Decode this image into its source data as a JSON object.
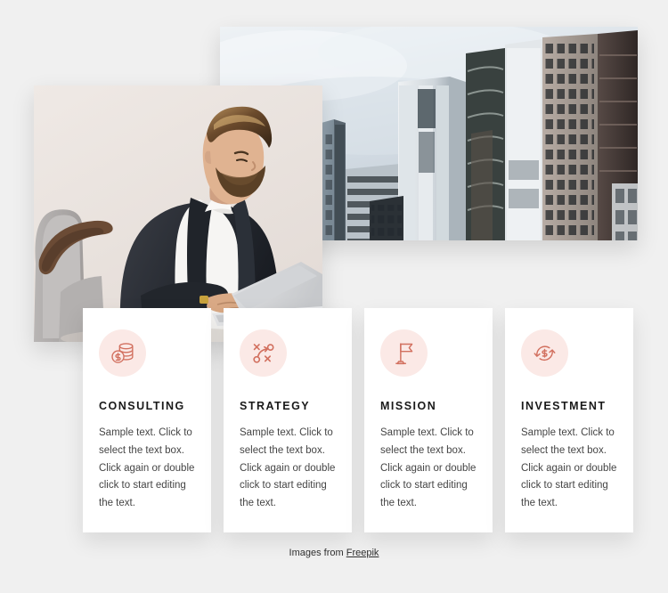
{
  "page": {
    "background_color": "#f0f0f0",
    "accent_color": "#d2705f",
    "icon_bg_color": "#fbe9e6",
    "card_bg_color": "#ffffff",
    "title_color": "#191919",
    "body_color": "#454545"
  },
  "media": [
    {
      "name": "city-buildings-photo",
      "alt": "Modern high-rise office buildings photographed from below against an overcast sky"
    },
    {
      "name": "businessman-laptop-photo",
      "alt": "Bearded man in a dark blazer and white t-shirt working on a laptop while seated in a grey armchair"
    }
  ],
  "cards": [
    {
      "icon": "coins-stack-dollar-icon",
      "title": "CONSULTING",
      "text": "Sample text. Click to select the text box. Click again or double click to start editing the text."
    },
    {
      "icon": "strategy-playbook-icon",
      "title": "STRATEGY",
      "text": "Sample text. Click to select the text box. Click again or double click to start editing the text."
    },
    {
      "icon": "flag-icon",
      "title": "MISSION",
      "text": "Sample text. Click to select the text box. Click again or double click to start editing the text."
    },
    {
      "icon": "money-refresh-dollar-icon",
      "title": "INVESTMENT",
      "text": "Sample text. Click to select the text box. Click again or double click to start editing the text."
    }
  ],
  "footer": {
    "prefix": "Images from",
    "link_label": "Freepik"
  }
}
